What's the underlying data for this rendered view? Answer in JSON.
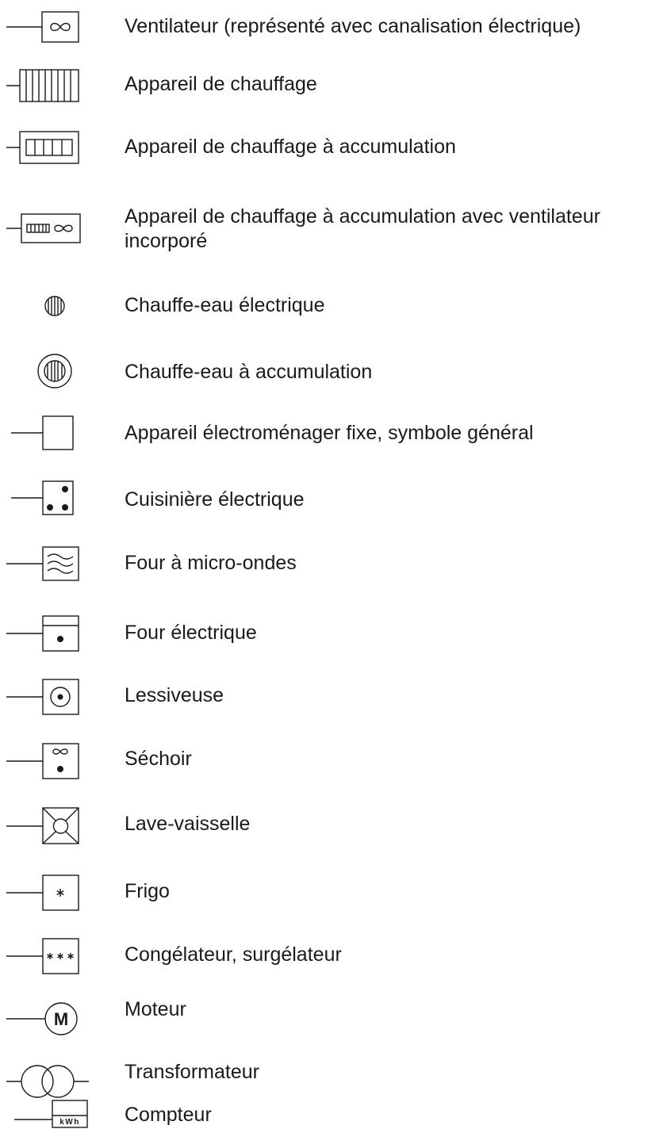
{
  "items": [
    {
      "symbol": "ventilator-icon",
      "label": "Ventilateur (représenté avec canalisation électrique)"
    },
    {
      "symbol": "heater-icon",
      "label": "Appareil de chauffage"
    },
    {
      "symbol": "storage-heater-icon",
      "label": "Appareil de chauffage à accumulation"
    },
    {
      "symbol": "storage-heater-fan-icon",
      "label": "Appareil de chauffage à accumulation avec ventilateur incorporé"
    },
    {
      "symbol": "water-heater-icon",
      "label": "Chauffe-eau électrique"
    },
    {
      "symbol": "storage-water-heater-icon",
      "label": "Chauffe-eau à accumulation"
    },
    {
      "symbol": "appliance-icon",
      "label": "Appareil électroménager fixe, symbole général"
    },
    {
      "symbol": "cooker-icon",
      "label": "Cuisinière électrique"
    },
    {
      "symbol": "microwave-icon",
      "label": "Four à micro-ondes"
    },
    {
      "symbol": "oven-icon",
      "label": "Four électrique"
    },
    {
      "symbol": "washing-machine-icon",
      "label": "Lessiveuse"
    },
    {
      "symbol": "dryer-icon",
      "label": "Séchoir"
    },
    {
      "symbol": "dishwasher-icon",
      "label": "Lave-vaisselle"
    },
    {
      "symbol": "fridge-icon",
      "label": "Frigo"
    },
    {
      "symbol": "freezer-icon",
      "label": "Congélateur, surgélateur"
    },
    {
      "symbol": "motor-icon",
      "label": "Moteur",
      "symbol_text": "M"
    },
    {
      "symbol": "transformer-icon",
      "label": "Transformateur"
    },
    {
      "symbol": "meter-icon",
      "label": "Compteur",
      "symbol_text": "kWh"
    }
  ]
}
